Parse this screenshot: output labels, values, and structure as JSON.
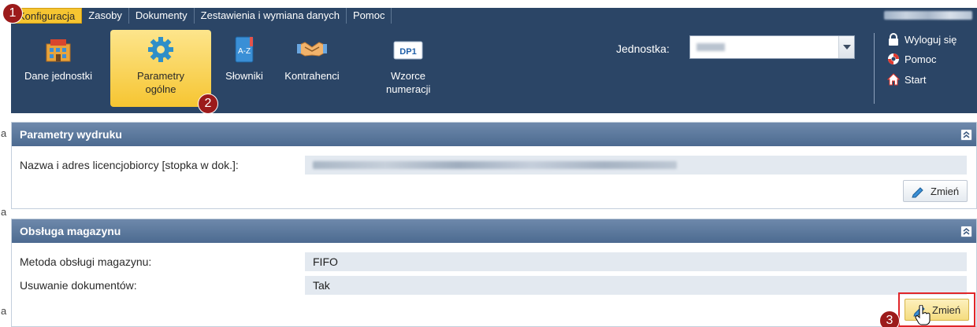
{
  "menubar": {
    "items": [
      "Konfiguracja",
      "Zasoby",
      "Dokumenty",
      "Zestawienia i wymiana danych",
      "Pomoc"
    ]
  },
  "ribbon": {
    "buttons": [
      {
        "label": "Dane jednostki",
        "icon": "building-icon"
      },
      {
        "label": "Parametry ogólne",
        "icon": "gear-icon"
      },
      {
        "label": "Słowniki",
        "icon": "dictionary-icon"
      },
      {
        "label": "Kontrahenci",
        "icon": "handshake-icon"
      },
      {
        "label": "Wzorce numeracji",
        "icon": "numbering-template-icon",
        "icon_text": "DP1"
      }
    ],
    "unit_label": "Jednostka:",
    "links": [
      {
        "label": "Wyloguj się",
        "icon": "lock-icon"
      },
      {
        "label": "Pomoc",
        "icon": "lifebuoy-icon"
      },
      {
        "label": "Start",
        "icon": "home-icon"
      }
    ]
  },
  "panels": {
    "print_params": {
      "title": "Parametry wydruku",
      "rows": [
        {
          "label": "Nazwa i adres licencjobiorcy [stopka w dok.]:",
          "value": ""
        }
      ],
      "edit_label": "Zmień"
    },
    "warehouse": {
      "title": "Obsługa magazynu",
      "rows": [
        {
          "label": "Metoda obsługi magazynu:",
          "value": "FIFO"
        },
        {
          "label": "Usuwanie dokumentów:",
          "value": "Tak"
        }
      ],
      "edit_label": "Zmień"
    }
  },
  "badges": [
    "1",
    "2",
    "3"
  ],
  "gutter": [
    "a",
    "a",
    "a"
  ],
  "colors": {
    "menubar_bg": "#2b4566",
    "active_tab": "#f6c531",
    "panel_header": "#5a7699",
    "highlight_frame": "#e0262a",
    "badge": "#9c1b1b"
  }
}
